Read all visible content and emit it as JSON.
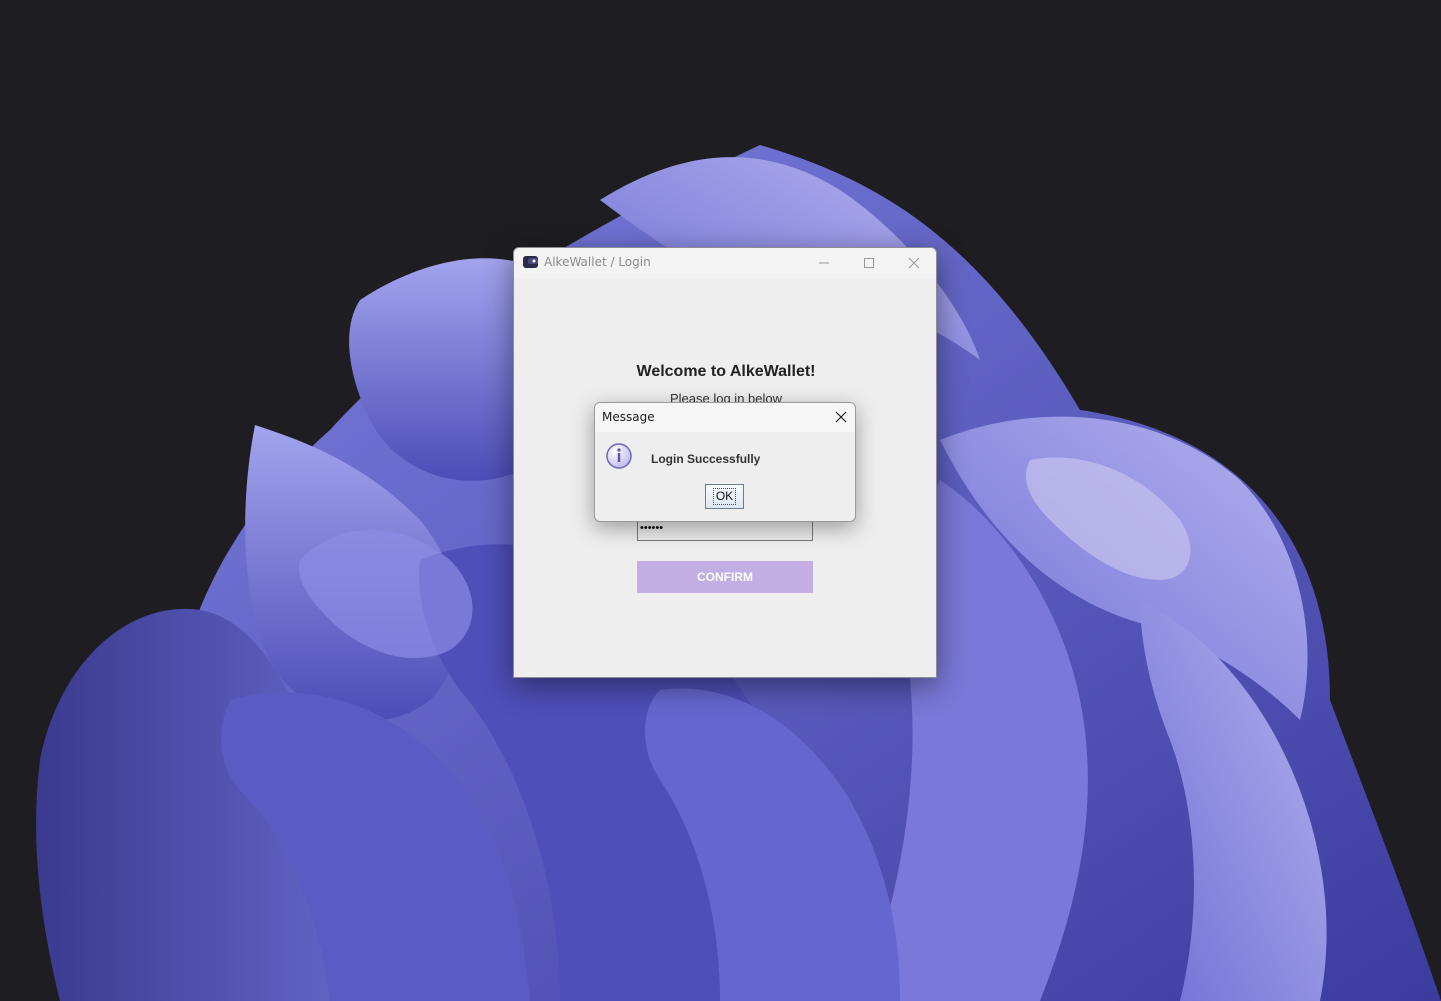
{
  "window": {
    "title": "AlkeWallet / Login"
  },
  "login": {
    "heading": "Welcome to AlkeWallet!",
    "subtitle": "Please log in below",
    "password_value": "••••••",
    "confirm_label": "CONFIRM"
  },
  "dialog": {
    "title": "Message",
    "message": "Login Successfully",
    "ok_label": "OK",
    "icon": "info-icon"
  },
  "colors": {
    "accent": "#c2aee3",
    "wallpaper_primary": "#5b5fc7",
    "desktop_background": "#1e1d22"
  }
}
